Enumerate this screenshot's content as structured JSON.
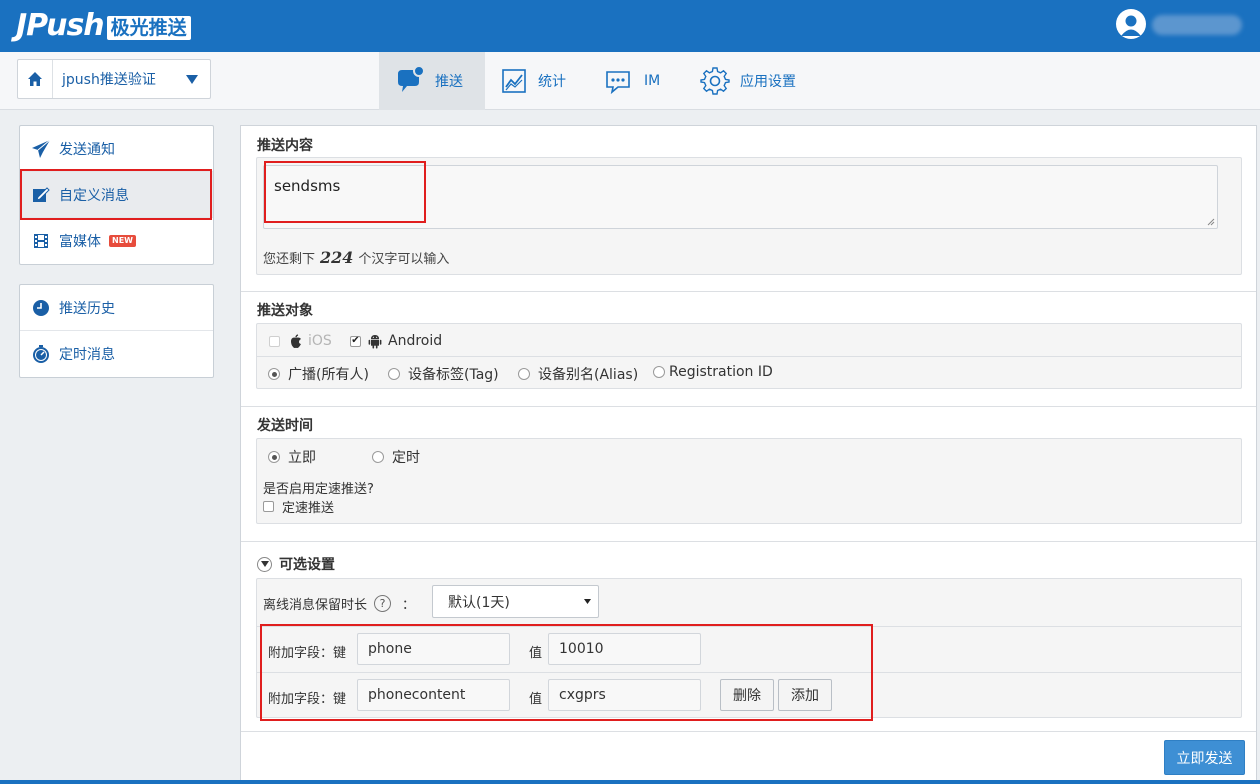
{
  "brand": {
    "logo_text": "JPush",
    "logo_cn": "极光推送",
    "accent": "#1a71c0"
  },
  "app_selector": {
    "value": "jpush推送验证",
    "icon": "home-icon"
  },
  "nav": [
    {
      "label": "推送",
      "icon": "push-bubble-icon",
      "active": true
    },
    {
      "label": "统计",
      "icon": "stats-chart-icon"
    },
    {
      "label": "IM",
      "icon": "im-chat-icon"
    },
    {
      "label": "应用设置",
      "icon": "gear-icon"
    }
  ],
  "sidebar": {
    "group1": [
      {
        "label": "发送通知",
        "icon": "paper-plane-icon"
      },
      {
        "label": "自定义消息",
        "icon": "edit-icon",
        "active": true
      },
      {
        "label": "富媒体",
        "icon": "film-icon",
        "badge": "NEW"
      }
    ],
    "group2": [
      {
        "label": "推送历史",
        "icon": "clock-icon"
      },
      {
        "label": "定时消息",
        "icon": "timer-icon"
      }
    ]
  },
  "content": {
    "title": "推送内容",
    "message": "sendsms",
    "remaining_prefix": "您还剩下",
    "remaining_count": "224",
    "remaining_suffix": "个汉字可以输入"
  },
  "target": {
    "title": "推送对象",
    "platforms": [
      {
        "label": "iOS",
        "checked": false,
        "disabled": true,
        "icon": "apple-icon"
      },
      {
        "label": "Android",
        "checked": true,
        "icon": "android-icon"
      }
    ],
    "audience": [
      {
        "label": "广播(所有人)",
        "selected": true
      },
      {
        "label": "设备标签(Tag)"
      },
      {
        "label": "设备别名(Alias)"
      },
      {
        "label": "Registration ID"
      }
    ]
  },
  "send_time": {
    "title": "发送时间",
    "options": [
      {
        "label": "立即",
        "selected": true
      },
      {
        "label": "定时"
      }
    ],
    "throttle_question": "是否启用定速推送?",
    "throttle_label": "定速推送"
  },
  "optional": {
    "title": "可选设置",
    "offline_label": "离线消息保留时长",
    "help": "?",
    "colon": "：",
    "offline_value": "默认(1天)",
    "extra_label": "附加字段：键",
    "value_label": "值",
    "extras": [
      {
        "key": "phone",
        "value": "10010"
      },
      {
        "key": "phonecontent",
        "value": "cxgprs"
      }
    ],
    "delete_label": "删除",
    "add_label": "添加"
  },
  "submit_label": "立即发送"
}
